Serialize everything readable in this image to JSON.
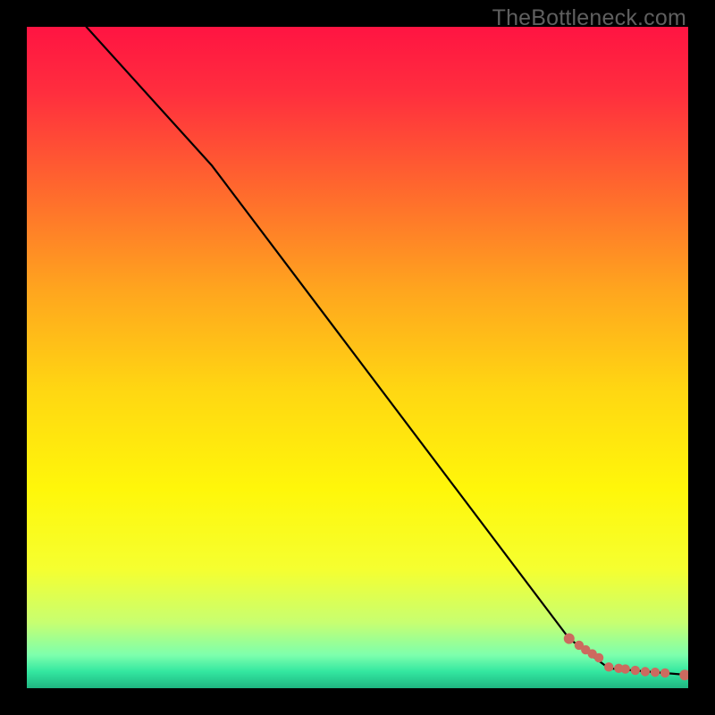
{
  "watermark": "TheBottleneck.com",
  "gradient": {
    "stops": [
      {
        "offset": 0.0,
        "color": "#ff1442"
      },
      {
        "offset": 0.1,
        "color": "#ff2e3e"
      },
      {
        "offset": 0.25,
        "color": "#ff6a2d"
      },
      {
        "offset": 0.4,
        "color": "#ffa61e"
      },
      {
        "offset": 0.55,
        "color": "#ffd712"
      },
      {
        "offset": 0.7,
        "color": "#fff70a"
      },
      {
        "offset": 0.82,
        "color": "#f5ff30"
      },
      {
        "offset": 0.9,
        "color": "#c8ff70"
      },
      {
        "offset": 0.95,
        "color": "#7dffad"
      },
      {
        "offset": 0.975,
        "color": "#33e7a0"
      },
      {
        "offset": 1.0,
        "color": "#1fb581"
      }
    ]
  },
  "chart_data": {
    "type": "line",
    "title": "",
    "xlabel": "",
    "ylabel": "",
    "xlim": [
      0,
      100
    ],
    "ylim": [
      0,
      100
    ],
    "series": [
      {
        "name": "curve",
        "x": [
          9,
          28,
          82,
          88,
          100
        ],
        "y": [
          100,
          79,
          7.5,
          3,
          2
        ]
      }
    ],
    "points": {
      "name": "cluster",
      "x": [
        82,
        83.5,
        84.5,
        85.5,
        86.5,
        88,
        89.5,
        90.5,
        92,
        93.5,
        95,
        96.5,
        99.5
      ],
      "y": [
        7.5,
        6.5,
        5.8,
        5.2,
        4.6,
        3.2,
        3.0,
        2.9,
        2.7,
        2.5,
        2.4,
        2.3,
        2.0
      ]
    },
    "point_color": "#cc6a5f",
    "line_color": "#000000"
  }
}
